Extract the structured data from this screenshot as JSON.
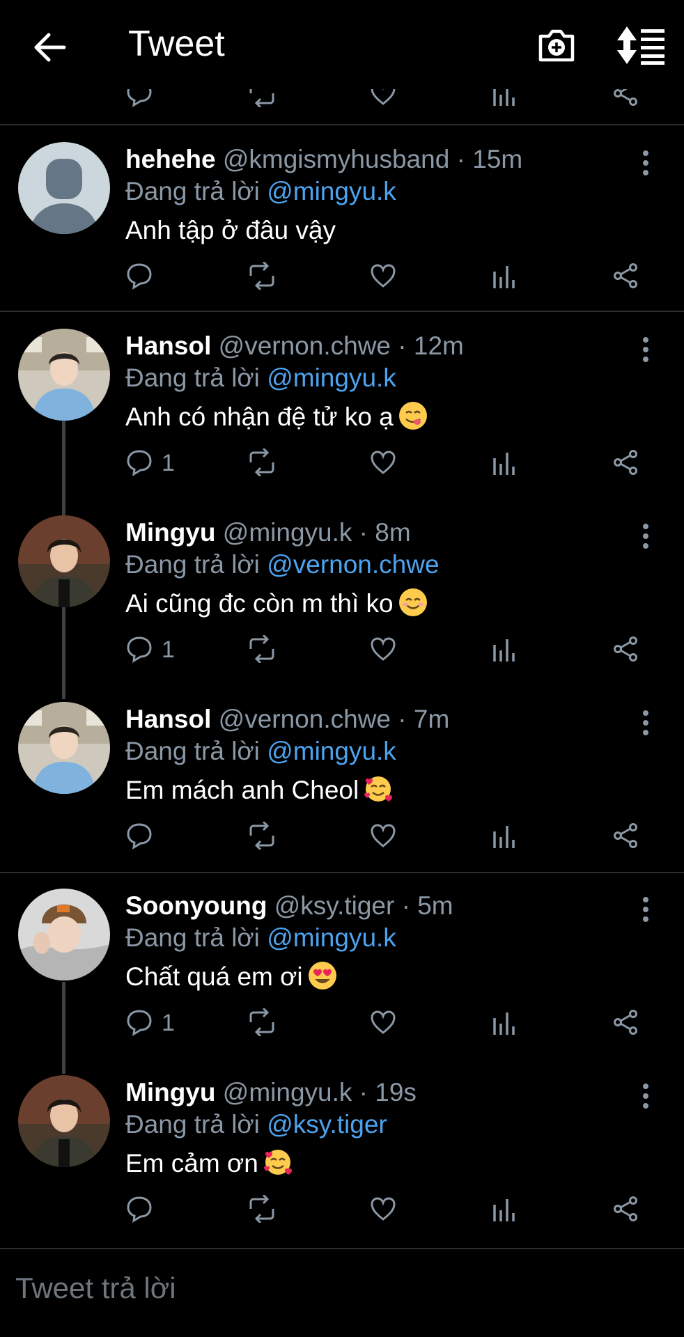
{
  "header": {
    "title": "Tweet",
    "back_icon": "arrow-left-icon",
    "camera_icon": "camera-plus-icon",
    "sort_icon": "sort-list-icon"
  },
  "colors": {
    "background": "#000000",
    "text": "#ffffff",
    "muted": "#8b98a5",
    "mention": "#4da3ee",
    "divider": "#2a2e33"
  },
  "replying_prefix": "Đang trả lời",
  "tweets": [
    {
      "name": "hehehe",
      "handle": "@kmgismyhusband",
      "time": "15m",
      "replying_to": "@mingyu.k",
      "text": "Anh tập ở đâu vậy",
      "emoji": "",
      "reply_count": "",
      "avatar": "default"
    },
    {
      "name": "Hansol",
      "handle": "@vernon.chwe",
      "time": "12m",
      "replying_to": "@mingyu.k",
      "text": "Anh có nhận đệ tử ko ạ",
      "emoji": "face-savoring-food",
      "reply_count": "1",
      "avatar": "hansol"
    },
    {
      "name": "Mingyu",
      "handle": "@mingyu.k",
      "time": "8m",
      "replying_to": "@vernon.chwe",
      "text": "Ai cũng đc còn m thì ko",
      "emoji": "smiling-face",
      "reply_count": "1",
      "avatar": "mingyu"
    },
    {
      "name": "Hansol",
      "handle": "@vernon.chwe",
      "time": "7m",
      "replying_to": "@mingyu.k",
      "text": "Em mách anh Cheol",
      "emoji": "smiling-face-with-hearts",
      "reply_count": "",
      "avatar": "hansol"
    },
    {
      "name": "Soonyoung",
      "handle": "@ksy.tiger",
      "time": "5m",
      "replying_to": "@mingyu.k",
      "text": "Chất quá em ơi",
      "emoji": "heart-eyes",
      "reply_count": "1",
      "avatar": "soonyoung"
    },
    {
      "name": "Mingyu",
      "handle": "@mingyu.k",
      "time": "19s",
      "replying_to": "@ksy.tiger",
      "text": "Em cảm ơn",
      "emoji": "smiling-face-with-hearts",
      "reply_count": "",
      "avatar": "mingyu"
    }
  ],
  "compose": {
    "placeholder": "Tweet trả lời"
  }
}
